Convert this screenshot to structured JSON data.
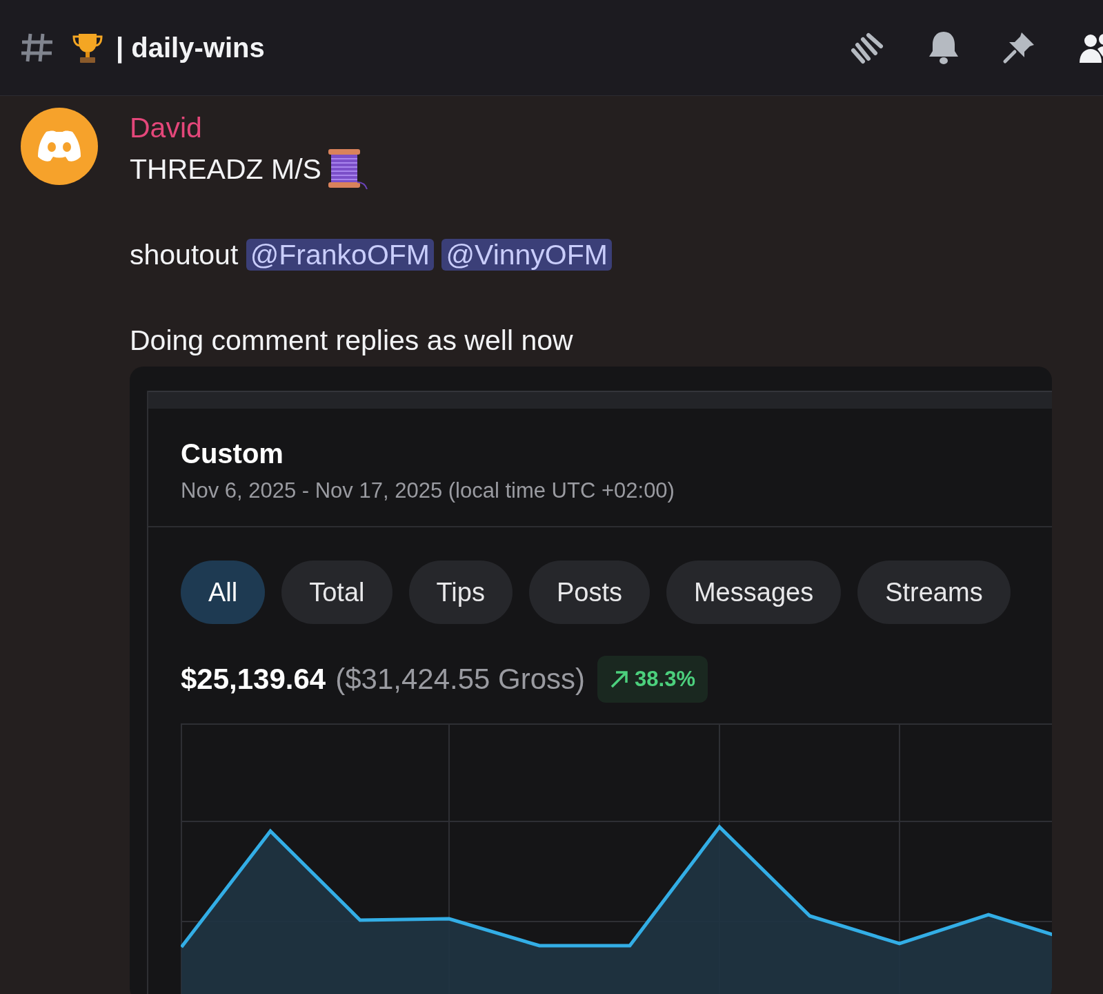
{
  "channel": {
    "name": "| daily-wins"
  },
  "message": {
    "author": "David",
    "title": "THREADZ M/S",
    "shoutout": {
      "text": "shoutout",
      "mentions": [
        "@FrankoOFM",
        "@VinnyOFM"
      ]
    },
    "body": "Doing comment replies as well now",
    "embed": {
      "title": "Custom",
      "date_range": "Nov 6, 2025 - Nov 17, 2025 (local time UTC +02:00)",
      "filters": [
        {
          "label": "All",
          "selected": true
        },
        {
          "label": "Total",
          "selected": false
        },
        {
          "label": "Tips",
          "selected": false
        },
        {
          "label": "Posts",
          "selected": false
        },
        {
          "label": "Messages",
          "selected": false
        },
        {
          "label": "Streams",
          "selected": false
        }
      ],
      "net": "$25,139.64",
      "gross": "($31,424.55 Gross)",
      "change": "38.3%"
    }
  }
}
